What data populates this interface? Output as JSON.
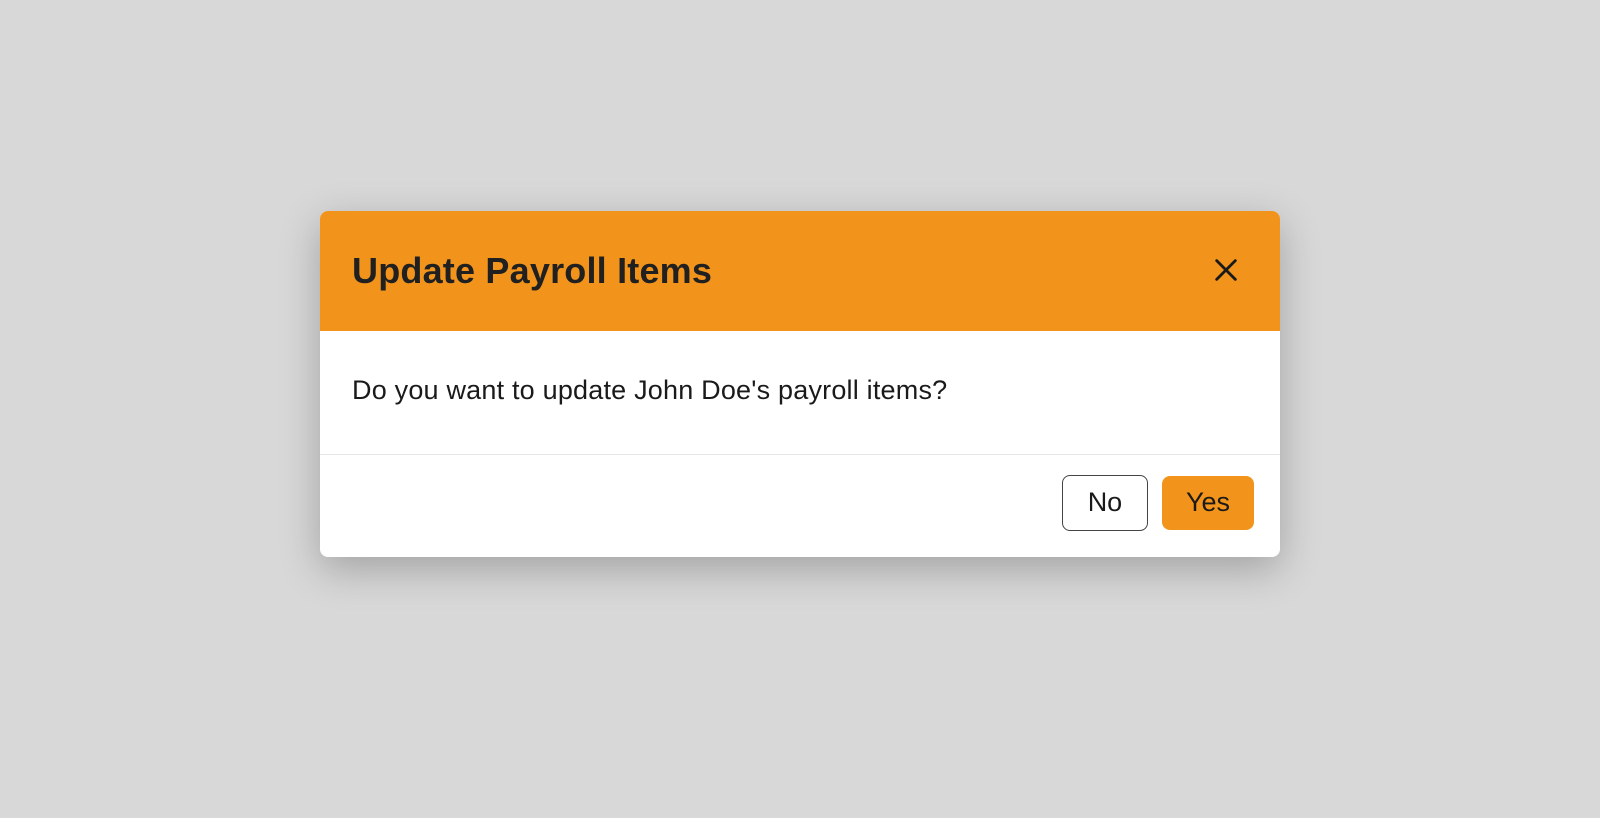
{
  "dialog": {
    "title": "Update Payroll Items",
    "message": "Do you want to update John Doe's payroll items?",
    "actions": {
      "no_label": "No",
      "yes_label": "Yes"
    },
    "accent_color": "#f2941b"
  }
}
